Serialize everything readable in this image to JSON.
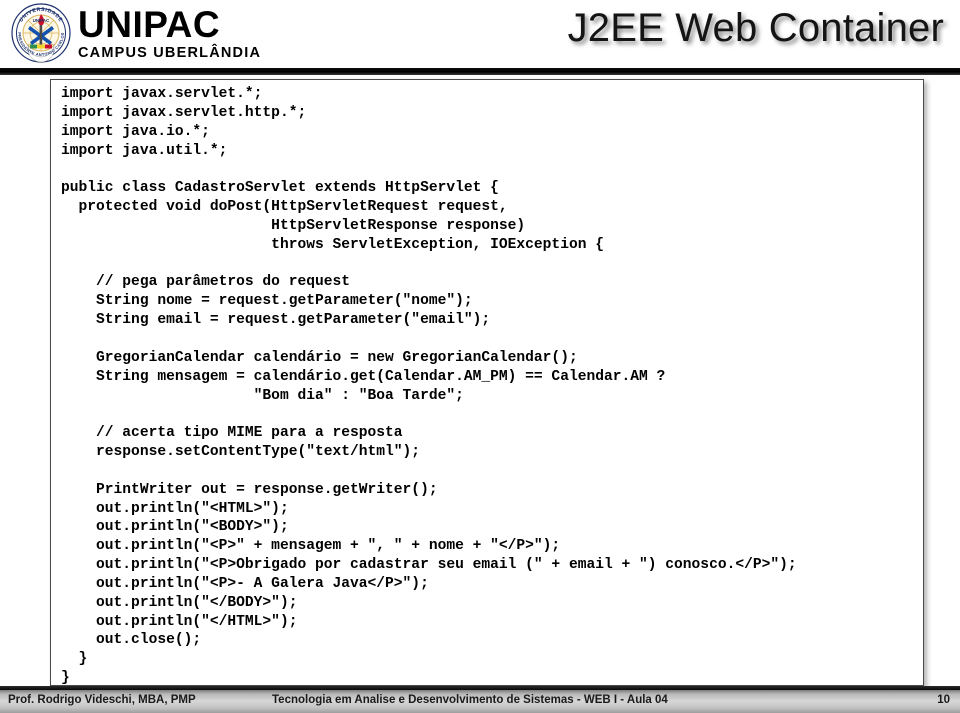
{
  "header": {
    "logo": {
      "icon": "unipac-crest-icon",
      "ring_top_text": "UNIVERSIDADE",
      "ring_inner_text": "UNIPAC",
      "ring_bottom_text": "PRESIDENTE ANTONIO CARLOS",
      "colors": {
        "ring": "#1b2f6b",
        "cross": "#1452b0",
        "flame": "#c8102e",
        "gold": "#d8b35a"
      }
    },
    "brand_name": "UNIPAC",
    "brand_sub": "CAMPUS UBERLÂNDIA",
    "slide_title": "J2EE Web Container"
  },
  "code": {
    "language": "java",
    "body": "import javax.servlet.*;\nimport javax.servlet.http.*;\nimport java.io.*;\nimport java.util.*;\n\npublic class CadastroServlet extends HttpServlet {\n  protected void doPost(HttpServletRequest request,\n                        HttpServletResponse response)\n                        throws ServletException, IOException {\n\n    // pega parâmetros do request\n    String nome = request.getParameter(\"nome\");\n    String email = request.getParameter(\"email\");\n\n    GregorianCalendar calendário = new GregorianCalendar();\n    String mensagem = calendário.get(Calendar.AM_PM) == Calendar.AM ?\n                      \"Bom dia\" : \"Boa Tarde\";\n\n    // acerta tipo MIME para a resposta\n    response.setContentType(\"text/html\");\n\n    PrintWriter out = response.getWriter();\n    out.println(\"<HTML>\");\n    out.println(\"<BODY>\");\n    out.println(\"<P>\" + mensagem + \", \" + nome + \"</P>\");\n    out.println(\"<P>Obrigado por cadastrar seu email (\" + email + \") conosco.</P>\");\n    out.println(\"<P>- A Galera Java</P>\");\n    out.println(\"</BODY>\");\n    out.println(\"</HTML>\");\n    out.close();\n  }\n}"
  },
  "footer": {
    "author": "Prof. Rodrigo Videschi, MBA, PMP",
    "course": "Tecnologia em Analise e Desenvolvimento de Sistemas - WEB I - Aula 04",
    "page_number": "10"
  }
}
